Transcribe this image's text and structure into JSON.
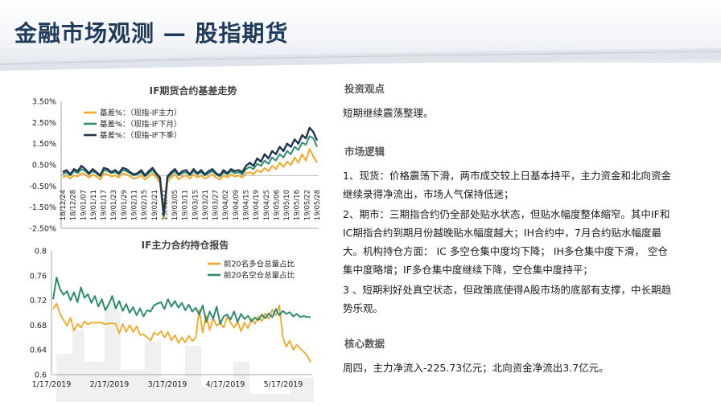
{
  "page": {
    "title": "金融市场观测 — 股指期货"
  },
  "right": {
    "sections": [
      {
        "heading": "投资观点",
        "paras": [
          "短期继续震荡整理。"
        ]
      },
      {
        "heading": "市场逻辑",
        "paras": [
          "1、现货：价格震荡下滑，两市成交较上日基本持平，主力资金和北向资金继续录得净流出，市场人气保持低迷；",
          "2、期市：三期指合约仍全部处贴水状态，但贴水幅度整体缩窄。其中IF和IC期指合约到期月份越晚贴水幅度越大；IH合约中，7月合约贴水幅度最大。机构持仓方面： IC 多空仓集中度均下降； IH多仓集中度下滑， 空仓集中度略增；IF多仓集中度继续下降，空仓集中度持平；",
          "3 、短期利好处真空状态，但政策底使得A股市场的底部有支撑，中长期趋势乐观。"
        ]
      },
      {
        "heading": "核心数据",
        "paras": [
          "周四，主力净流入-225.73亿元；北向资金净流出3.7亿元。"
        ]
      }
    ]
  },
  "chart_data": [
    {
      "type": "line",
      "title": "IF期货合约基差走势",
      "ylim": [
        -2.5,
        3.5
      ],
      "yticks": [
        "-2.50%",
        "-1.50%",
        "-0.50%",
        "0.50%",
        "1.50%",
        "2.50%",
        "3.50%"
      ],
      "ytick_values": [
        -2.5,
        -1.5,
        -0.5,
        0.5,
        1.5,
        2.5,
        3.5
      ],
      "xticks": [
        "18/12/24",
        "18/12/28",
        "19/01/07",
        "19/01/11",
        "19/01/17",
        "19/01/23",
        "19/01/29",
        "19/02/11",
        "19/02/15",
        "19/02/21",
        "19/02/27",
        "19/03/05",
        "19/03/11",
        "19/03/15",
        "19/03/21",
        "19/03/27",
        "19/04/02",
        "19/04/09",
        "19/04/15",
        "19/04/19",
        "19/04/25",
        "19/05/06",
        "19/05/10",
        "19/05/16",
        "19/05/22",
        "19/05/28"
      ],
      "legend_position": "top-left",
      "series": [
        {
          "name": "基差%：（现指-IF主力）",
          "color": "#f5a623",
          "values": [
            -0.1,
            0.0,
            -0.15,
            0.0,
            -0.05,
            0.1,
            0.05,
            -0.1,
            0.05,
            -0.05,
            -0.2,
            0.1,
            0.05,
            -0.05,
            0.0,
            -0.1,
            0.1,
            0.05,
            -0.05,
            -0.15,
            -0.1,
            0.0,
            -0.2,
            -0.05,
            0.1,
            -0.1,
            -0.35,
            -2.05,
            -0.3,
            -0.1,
            0.05,
            -0.2,
            -0.05,
            0.0,
            -0.15,
            0.05,
            -0.1,
            0.0,
            -0.15,
            -0.05,
            0.05,
            -0.1,
            -0.2,
            0.0,
            -0.1,
            0.05,
            -0.05,
            0.0,
            -0.1,
            0.1,
            0.15,
            0.05,
            0.25,
            0.15,
            0.35,
            0.2,
            0.45,
            0.3,
            0.6,
            0.4,
            0.65,
            0.5,
            0.85,
            0.6,
            1.0,
            0.7,
            1.25,
            0.9,
            0.6
          ]
        },
        {
          "name": "基差%：（现指-IF下月）",
          "color": "#2e8b6e",
          "values": [
            0.05,
            0.15,
            0.0,
            0.2,
            0.1,
            0.3,
            0.2,
            0.05,
            0.2,
            0.1,
            -0.05,
            0.25,
            0.2,
            0.1,
            0.15,
            0.05,
            0.25,
            0.2,
            0.1,
            0.0,
            0.05,
            0.15,
            -0.05,
            0.1,
            0.25,
            0.05,
            -0.2,
            -1.95,
            -0.15,
            0.05,
            0.2,
            0.0,
            0.1,
            0.15,
            0.0,
            0.2,
            0.05,
            0.15,
            0.0,
            0.1,
            0.2,
            0.05,
            -0.05,
            0.15,
            0.05,
            0.2,
            0.1,
            0.15,
            0.05,
            0.3,
            0.4,
            0.3,
            0.55,
            0.45,
            0.7,
            0.55,
            0.85,
            0.7,
            1.0,
            0.85,
            1.15,
            1.0,
            1.35,
            1.2,
            1.55,
            1.45,
            1.85,
            1.75,
            1.35
          ]
        },
        {
          "name": "基差%：（现指-IF下季）",
          "color": "#1f3550",
          "values": [
            0.15,
            0.25,
            0.05,
            0.3,
            0.2,
            0.45,
            0.3,
            0.1,
            0.3,
            0.15,
            0.0,
            0.35,
            0.3,
            0.15,
            0.25,
            0.1,
            0.35,
            0.3,
            0.15,
            0.05,
            0.1,
            0.25,
            0.0,
            0.2,
            0.35,
            0.1,
            -0.1,
            -1.85,
            -0.05,
            0.15,
            0.3,
            0.05,
            0.2,
            0.25,
            0.05,
            0.3,
            0.1,
            0.25,
            0.05,
            0.2,
            0.3,
            0.1,
            0.0,
            0.25,
            0.1,
            0.3,
            0.2,
            0.25,
            0.15,
            0.45,
            0.6,
            0.45,
            0.8,
            0.65,
            1.0,
            0.8,
            1.15,
            1.0,
            1.35,
            1.15,
            1.5,
            1.35,
            1.7,
            1.5,
            1.9,
            1.75,
            2.25,
            2.05,
            1.65
          ]
        }
      ]
    },
    {
      "type": "line",
      "title": "IF主力合约持仓报告",
      "ylim": [
        0.6,
        0.8
      ],
      "yticks": [
        "0.6",
        "0.64",
        "0.68",
        "0.72",
        "0.76",
        "0.8"
      ],
      "ytick_values": [
        0.6,
        0.64,
        0.68,
        0.72,
        0.76,
        0.8
      ],
      "xticks": [
        "1/17/2019",
        "2/17/2019",
        "3/17/2019",
        "4/17/2019",
        "5/17/2019"
      ],
      "legend_position": "top-right",
      "series": [
        {
          "name": "前20名多仓总量占比",
          "color": "#f5a623",
          "values": [
            0.706,
            0.715,
            0.698,
            0.688,
            0.679,
            0.692,
            0.671,
            0.682,
            0.676,
            0.686,
            0.681,
            0.684,
            0.684,
            0.684,
            0.684,
            0.681,
            0.683,
            0.683,
            0.682,
            0.667,
            0.682,
            0.669,
            0.68,
            0.669,
            0.678,
            0.664,
            0.665,
            0.66,
            0.655,
            0.668,
            0.664,
            0.67,
            0.66,
            0.669,
            0.655,
            0.664,
            0.651,
            0.66,
            0.652,
            0.663,
            0.654,
            0.66,
            0.705,
            0.668,
            0.695,
            0.672,
            0.691,
            0.679,
            0.684,
            0.676,
            0.693,
            0.684,
            0.676,
            0.686,
            0.67,
            0.684,
            0.675,
            0.69,
            0.682,
            0.694,
            0.686,
            0.699,
            0.69,
            0.705,
            0.696,
            0.712,
            0.661,
            0.645,
            0.655,
            0.64,
            0.648,
            0.642,
            0.637,
            0.631,
            0.62
          ]
        },
        {
          "name": "前20名空仓总量占比",
          "color": "#2e8b6e",
          "values": [
            0.722,
            0.757,
            0.738,
            0.729,
            0.735,
            0.72,
            0.733,
            0.717,
            0.741,
            0.724,
            0.73,
            0.716,
            0.727,
            0.71,
            0.722,
            0.704,
            0.714,
            0.727,
            0.707,
            0.719,
            0.703,
            0.714,
            0.7,
            0.709,
            0.696,
            0.707,
            0.694,
            0.704,
            0.702,
            0.712,
            0.715,
            0.717,
            0.706,
            0.722,
            0.71,
            0.719,
            0.708,
            0.716,
            0.704,
            0.713,
            0.702,
            0.708,
            0.697,
            0.712,
            0.685,
            0.702,
            0.69,
            0.71,
            0.682,
            0.694,
            0.697,
            0.689,
            0.702,
            0.685,
            0.698,
            0.69,
            0.695,
            0.686,
            0.692,
            0.688,
            0.697,
            0.691,
            0.699,
            0.693,
            0.706,
            0.696,
            0.703,
            0.698,
            0.701,
            0.694,
            0.698,
            0.693,
            0.695,
            0.693,
            0.693
          ]
        }
      ]
    }
  ]
}
